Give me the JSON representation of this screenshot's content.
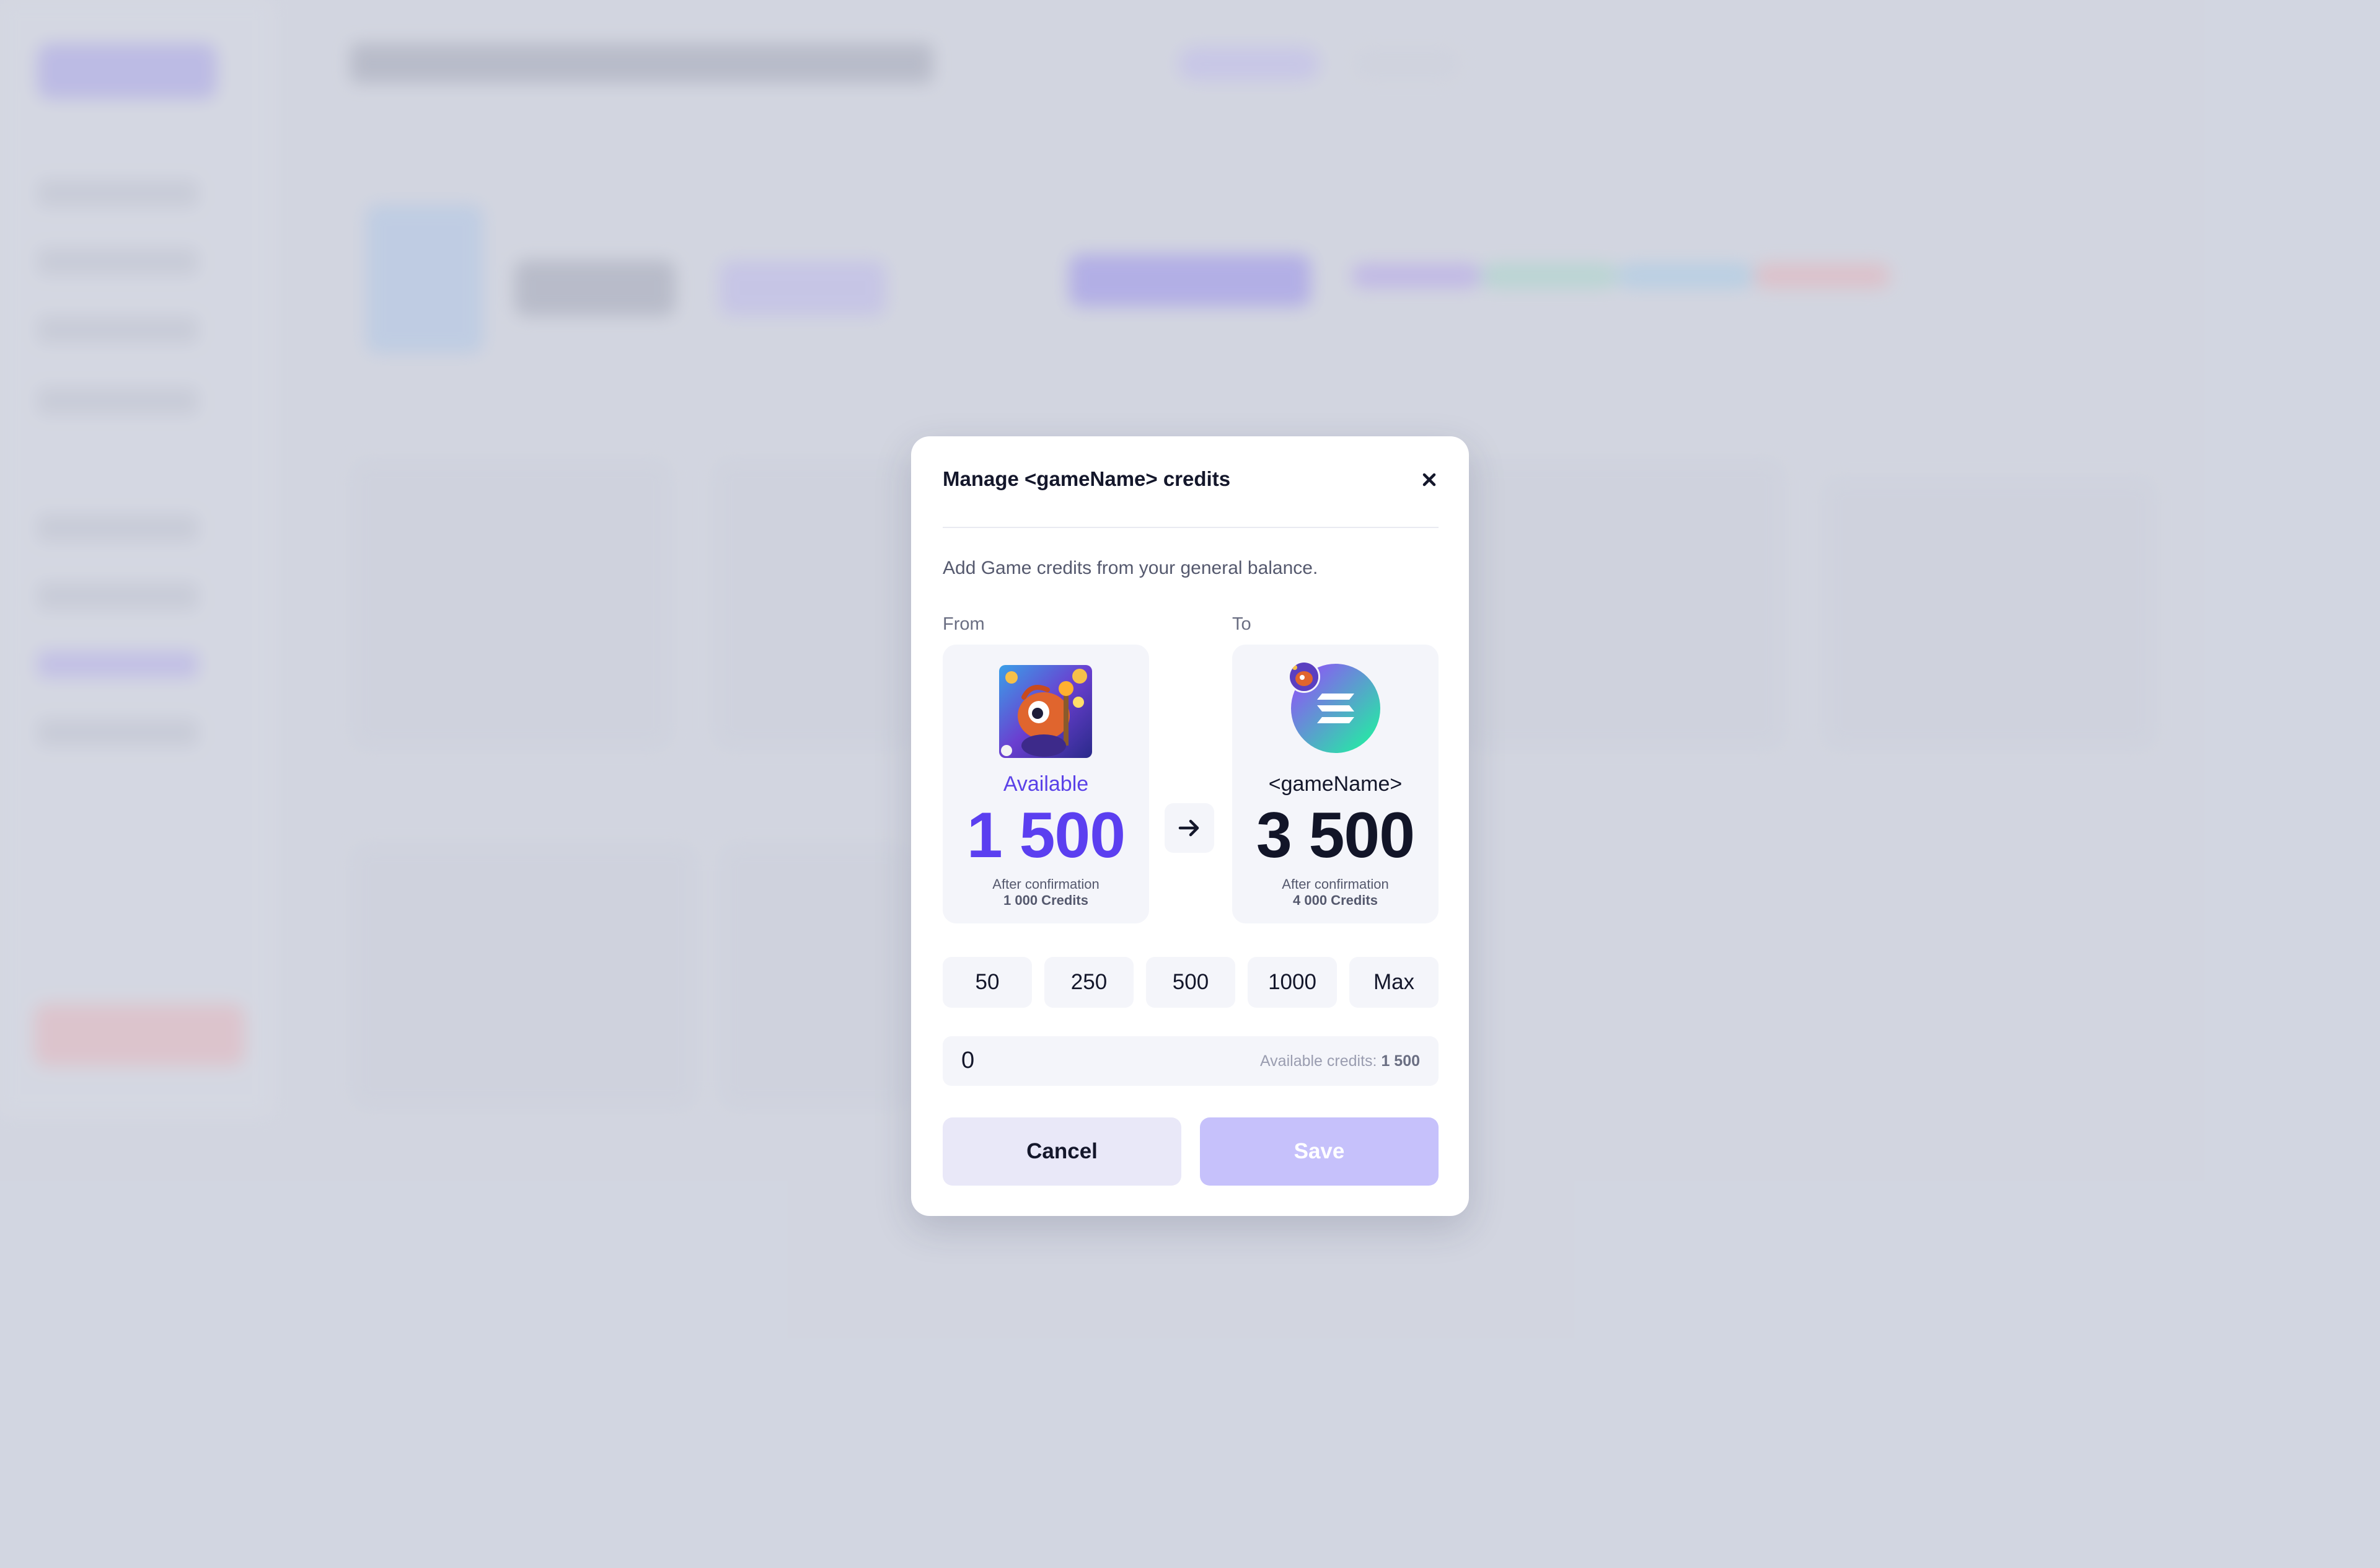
{
  "modal": {
    "title": "Manage <gameName> credits",
    "subtitle": "Add Game credits from your general balance.",
    "from_label": "From",
    "to_label": "To",
    "from": {
      "caption": "Available",
      "amount": "1 500",
      "after_label": "After confirmation",
      "after_value": "1 000 Credits"
    },
    "to": {
      "caption": "<gameName>",
      "amount": "3 500",
      "after_label": "After confirmation",
      "after_value": "4 000 Credits"
    },
    "quick_amounts": [
      "50",
      "250",
      "500",
      "1000",
      "Max"
    ],
    "amount_input": {
      "value": "0",
      "hint_prefix": "Available credits:",
      "hint_value": "1 500"
    },
    "cancel_label": "Cancel",
    "save_label": "Save"
  },
  "colors": {
    "accent": "#5b3ff0",
    "save_disabled": "#c6c1fb",
    "cancel_bg": "#e9e8f8",
    "panel_bg": "#f4f5fa",
    "backdrop": "#d5d8e2"
  },
  "icons": {
    "close": "close-icon",
    "arrow": "arrow-right-icon",
    "token": "solana-token-icon"
  }
}
